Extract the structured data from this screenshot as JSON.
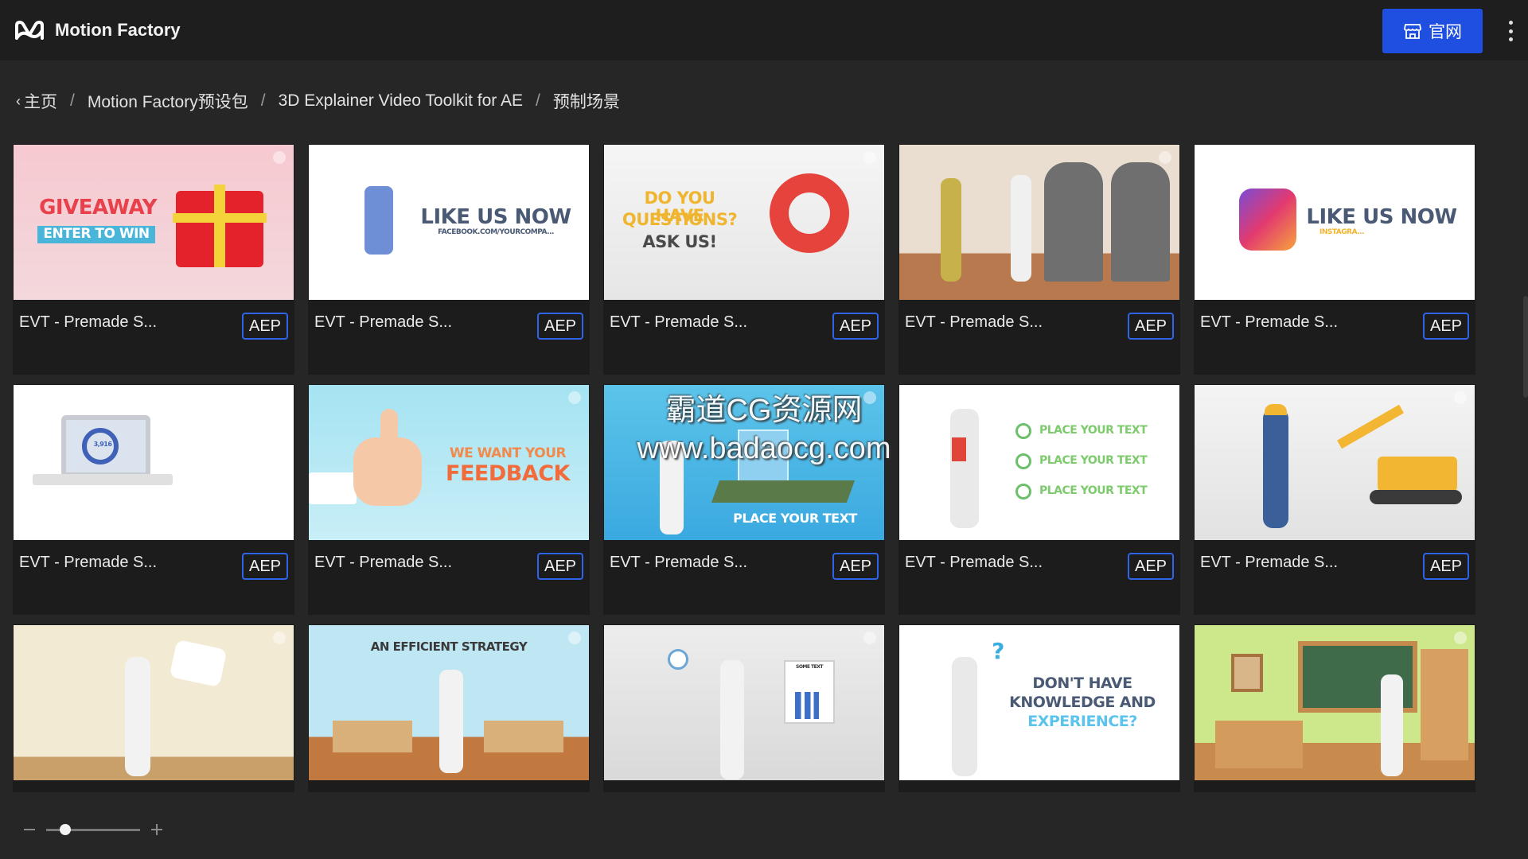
{
  "app": {
    "title": "Motion Factory",
    "logo_icon": "motion-factory-logo-icon"
  },
  "header": {
    "site_button_label": "官网",
    "site_button_icon": "storefront-icon",
    "menu_icon": "kebab-menu-icon"
  },
  "breadcrumb": [
    "主页",
    "Motion Factory预设包",
    "3D Explainer Video Toolkit for AE",
    "预制场景"
  ],
  "breadcrumb_separator": "/",
  "breadcrumb_back_icon": "‹",
  "cards": [
    {
      "title": "EVT - Premade S...",
      "badge": "AEP",
      "texts": [
        "GIVEAWAY",
        "ENTER TO WIN"
      ]
    },
    {
      "title": "EVT - Premade S...",
      "badge": "AEP",
      "texts": [
        "LIKE US NOW",
        "FACEBOOK.COM/YOURCOMPA..."
      ]
    },
    {
      "title": "EVT - Premade S...",
      "badge": "AEP",
      "texts": [
        "DO YOU HAVE",
        "QUESTIONS?",
        "ASK US!"
      ]
    },
    {
      "title": "EVT - Premade S...",
      "badge": "AEP",
      "texts": []
    },
    {
      "title": "EVT - Premade S...",
      "badge": "AEP",
      "texts": [
        "LIKE US NOW",
        "INSTAGRA..."
      ]
    },
    {
      "title": "EVT - Premade S...",
      "badge": "AEP",
      "texts": [
        "3,916"
      ]
    },
    {
      "title": "EVT - Premade S...",
      "badge": "AEP",
      "texts": [
        "WE WANT YOUR",
        "FEEDBACK"
      ]
    },
    {
      "title": "EVT - Premade S...",
      "badge": "AEP",
      "texts": [
        "PLACE YOUR TEXT"
      ]
    },
    {
      "title": "EVT - Premade S...",
      "badge": "AEP",
      "texts": [
        "PLACE YOUR TEXT",
        "PLACE YOUR TEXT",
        "PLACE YOUR TEXT"
      ]
    },
    {
      "title": "EVT - Premade S...",
      "badge": "AEP",
      "texts": []
    },
    {
      "title": "",
      "badge": "",
      "texts": []
    },
    {
      "title": "",
      "badge": "",
      "texts": [
        "AN EFFICIENT STRATEGY"
      ]
    },
    {
      "title": "",
      "badge": "",
      "texts": [
        "SOME TEXT"
      ]
    },
    {
      "title": "",
      "badge": "",
      "texts": [
        "DON'T HAVE",
        "KNOWLEDGE AND",
        "EXPERIENCE?"
      ]
    },
    {
      "title": "",
      "badge": "",
      "texts": []
    }
  ],
  "watermark": {
    "line1": "霸道CG资源网",
    "line2": "www.badaocg.com"
  },
  "zoom": {
    "level": 0.2,
    "minus_icon": "minus-icon",
    "plus_icon": "plus-icon"
  },
  "colors": {
    "accent": "#1f4fe0",
    "badge_border": "#2f63e8",
    "background": "#262626",
    "topbar": "#1e1e1e"
  }
}
